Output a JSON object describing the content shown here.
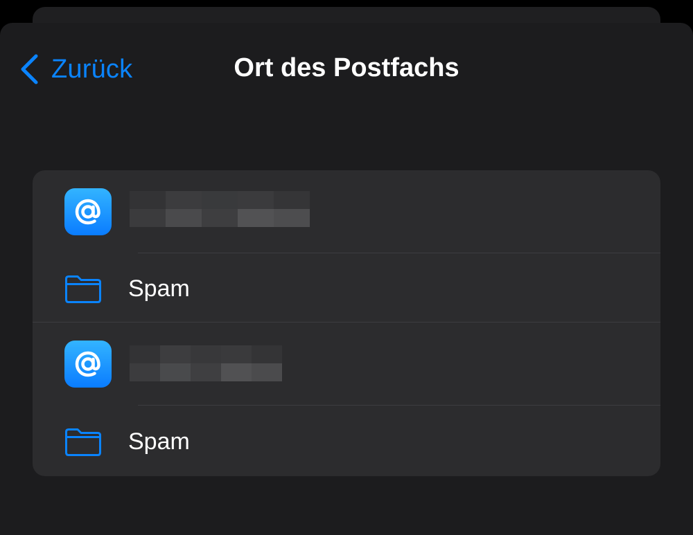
{
  "nav": {
    "back_label": "Zurück",
    "title": "Ort des Postfachs"
  },
  "accounts": [
    {
      "icon": "mail-at-icon",
      "redacted_name": true,
      "mailbox": {
        "icon": "folder-icon",
        "label": "Spam"
      }
    },
    {
      "icon": "mail-at-icon",
      "redacted_name": true,
      "mailbox": {
        "icon": "folder-icon",
        "label": "Spam"
      }
    }
  ],
  "colors": {
    "accent": "#0a84ff",
    "background": "#1c1c1e",
    "group_background": "#2c2c2e",
    "separator": "#3d3d41"
  }
}
